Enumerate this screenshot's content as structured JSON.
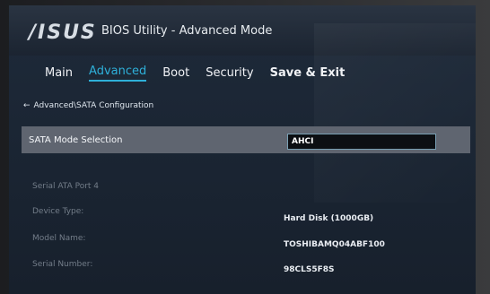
{
  "brand": "/ISUS",
  "window_title": "BIOS Utility - Advanced Mode",
  "tabs": [
    {
      "label": "Main",
      "active": false
    },
    {
      "label": "Advanced",
      "active": true
    },
    {
      "label": "Boot",
      "active": false
    },
    {
      "label": "Security",
      "active": false
    },
    {
      "label": "Save & Exit",
      "active": false
    }
  ],
  "breadcrumb": {
    "arrow": "←",
    "path": "Advanced\\SATA Configuration"
  },
  "sata_mode": {
    "label": "SATA Mode Selection",
    "value": "AHCI"
  },
  "port": {
    "title": "Serial ATA Port 4",
    "fields": [
      {
        "label": "Device Type:",
        "value": "Hard Disk (1000GB)"
      },
      {
        "label": "Model Name:",
        "value": "TOSHIBAMQ04ABF100"
      },
      {
        "label": "Serial Number:",
        "value": "98CLS5F8S"
      }
    ]
  },
  "colors": {
    "accent": "#2eb0d9",
    "highlight_row": "#5f6570",
    "background": "#1e2a3a"
  }
}
